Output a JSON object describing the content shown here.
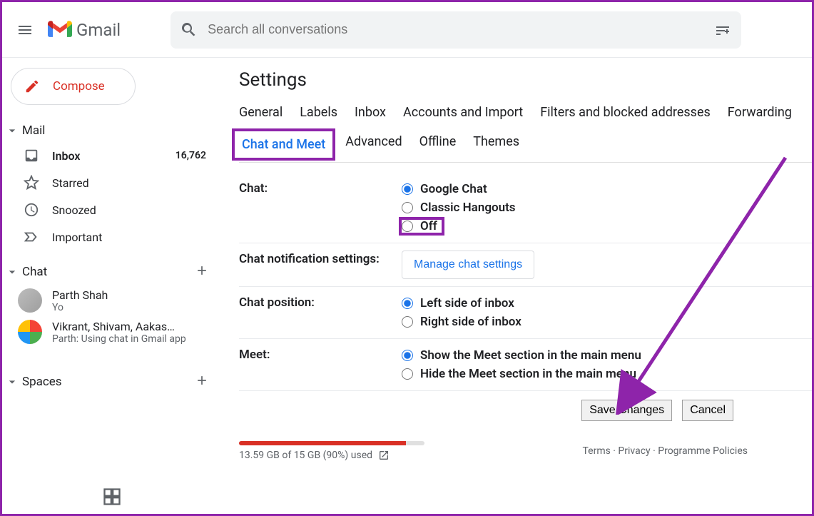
{
  "header": {
    "logo_text": "Gmail",
    "search_placeholder": "Search all conversations"
  },
  "sidebar": {
    "compose": "Compose",
    "sections": {
      "mail": "Mail",
      "chat": "Chat",
      "spaces": "Spaces"
    },
    "mail_items": [
      {
        "icon": "inbox",
        "label": "Inbox",
        "count": "16,762",
        "bold": true
      },
      {
        "icon": "star",
        "label": "Starred"
      },
      {
        "icon": "clock",
        "label": "Snoozed"
      },
      {
        "icon": "important",
        "label": "Important"
      }
    ],
    "chat_items": [
      {
        "name": "Parth Shah",
        "snippet": "Yo",
        "avatar": "single"
      },
      {
        "name": "Vikrant, Shivam, Aakas…",
        "snippet": "Parth: Using chat in Gmail app",
        "avatar": "group"
      }
    ]
  },
  "settings": {
    "title": "Settings",
    "tabs": [
      "General",
      "Labels",
      "Inbox",
      "Accounts and Import",
      "Filters and blocked addresses",
      "Forwarding",
      "Chat and Meet",
      "Advanced",
      "Offline",
      "Themes"
    ],
    "active_tab": "Chat and Meet",
    "rows": {
      "chat": {
        "label": "Chat:",
        "options": [
          "Google Chat",
          "Classic Hangouts",
          "Off"
        ],
        "selected": "Google Chat"
      },
      "notifications": {
        "label": "Chat notification settings:",
        "button": "Manage chat settings"
      },
      "position": {
        "label": "Chat position:",
        "options": [
          "Left side of inbox",
          "Right side of inbox"
        ],
        "selected": "Left side of inbox"
      },
      "meet": {
        "label": "Meet:",
        "options": [
          "Show the Meet section in the main menu",
          "Hide the Meet section in the main menu"
        ],
        "selected": "Show the Meet section in the main menu"
      }
    },
    "save": "Save Changes",
    "cancel": "Cancel"
  },
  "footer": {
    "storage_text": "13.59 GB of 15 GB (90%) used",
    "links": "Terms · Privacy · Programme Policies"
  }
}
